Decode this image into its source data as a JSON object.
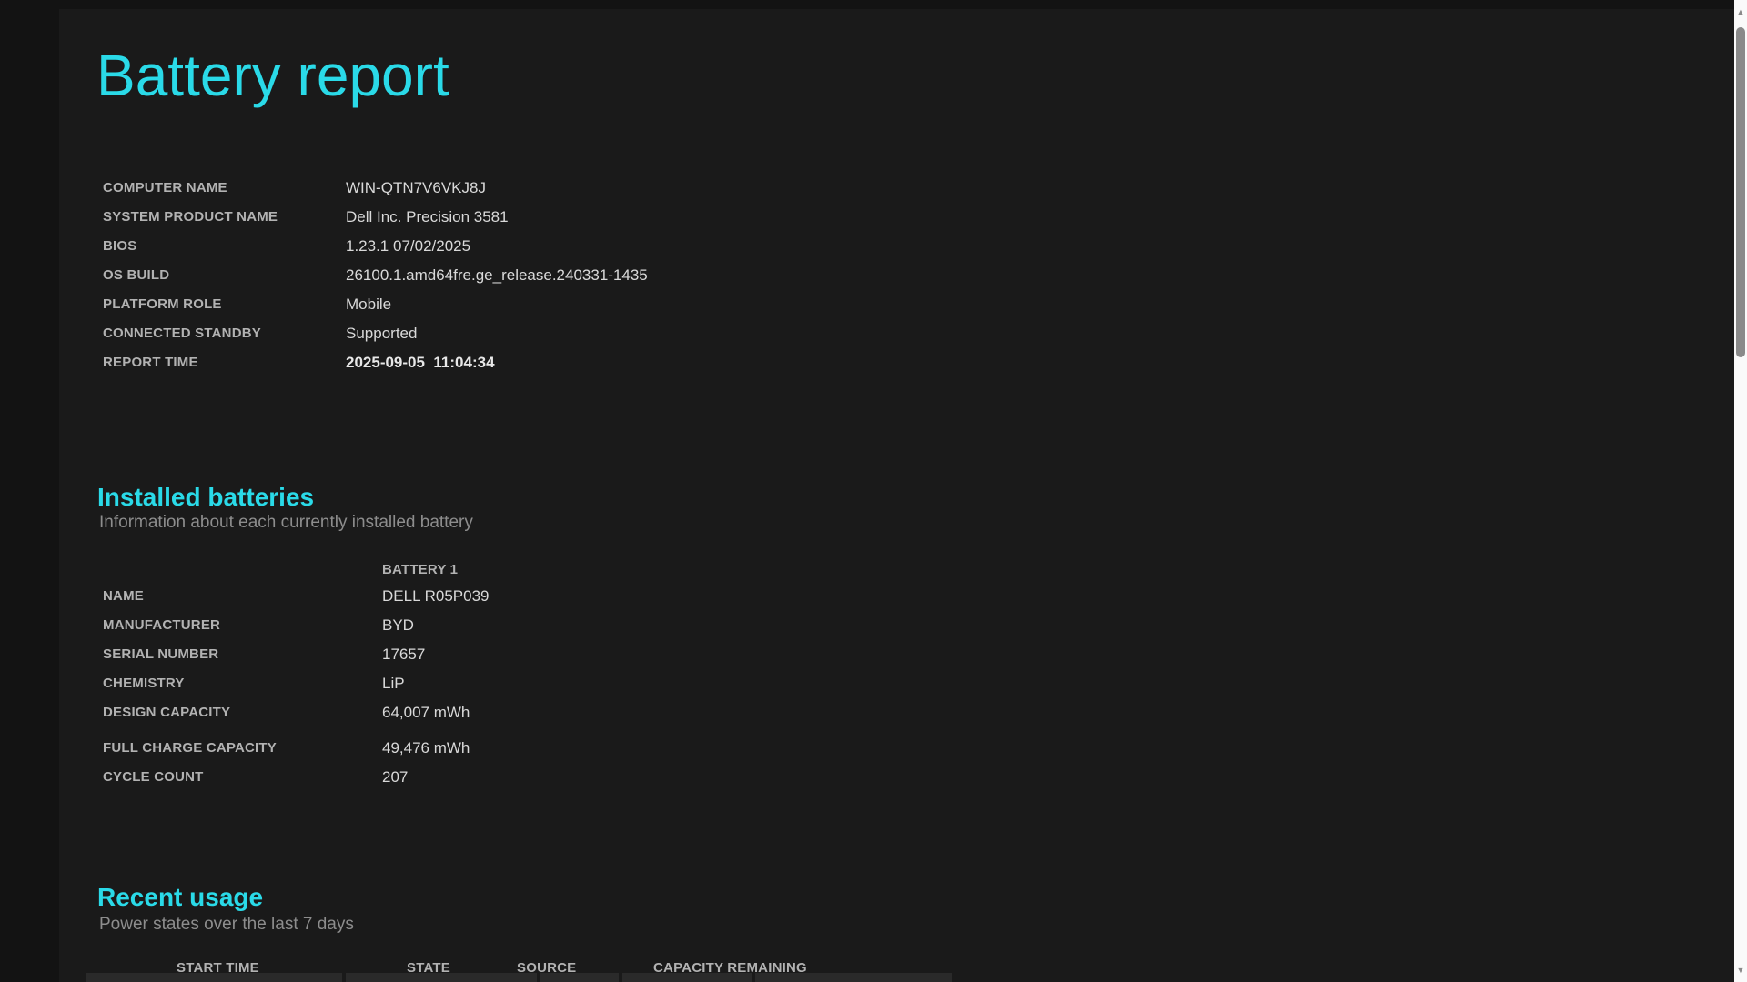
{
  "page": {
    "title": "Battery report"
  },
  "system_info": {
    "rows": [
      {
        "label": "COMPUTER NAME",
        "value": "WIN-QTN7V6VKJ8J"
      },
      {
        "label": "SYSTEM PRODUCT NAME",
        "value": "Dell Inc. Precision 3581"
      },
      {
        "label": "BIOS",
        "value": "1.23.1 07/02/2025"
      },
      {
        "label": "OS BUILD",
        "value": "26100.1.amd64fre.ge_release.240331-1435"
      },
      {
        "label": "PLATFORM ROLE",
        "value": "Mobile"
      },
      {
        "label": "CONNECTED STANDBY",
        "value": "Supported"
      },
      {
        "label": "REPORT TIME",
        "value": "2025-09-05  11:04:34"
      }
    ]
  },
  "installed_batteries": {
    "heading": "Installed batteries",
    "subtitle": "Information about each currently installed battery",
    "column_header": "BATTERY 1",
    "rows": [
      {
        "label": "NAME",
        "value": "DELL R05P039"
      },
      {
        "label": "MANUFACTURER",
        "value": "BYD"
      },
      {
        "label": "SERIAL NUMBER",
        "value": "17657"
      },
      {
        "label": "CHEMISTRY",
        "value": "LiP"
      },
      {
        "label": "DESIGN CAPACITY",
        "value": "64,007 mWh"
      },
      {
        "label": "FULL CHARGE CAPACITY",
        "value": "49,476 mWh"
      },
      {
        "label": "CYCLE COUNT",
        "value": "207"
      }
    ]
  },
  "recent_usage": {
    "heading": "Recent usage",
    "subtitle": "Power states over the last 7 days",
    "columns": [
      "START TIME",
      "STATE",
      "SOURCE",
      "CAPACITY REMAINING"
    ]
  },
  "scrollbar": {
    "up_icon": "▲",
    "down_icon": "▼"
  },
  "colors": {
    "accent_cyan": "#2adae8",
    "page_background": "#1a1a1a",
    "outer_background": "#131313",
    "row_shade": "#2a2a2a",
    "label_gray": "#b2b2b2",
    "value_gray": "#d9d9d9"
  }
}
